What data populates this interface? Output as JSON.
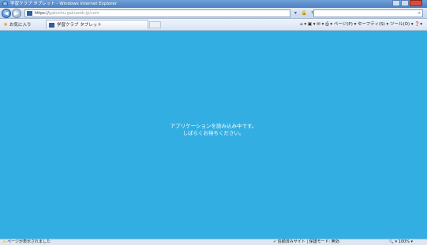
{
  "titlebar": {
    "title": "学習クラブ タブレット - Windows Internet Explorer"
  },
  "addressbar": {
    "url_prefix": "https://",
    "url_host": "gakushu.gakuweb.jp",
    "url_path": "/com",
    "search_placeholder": ""
  },
  "favbar": {
    "favorites_label": "お気に入り",
    "tab_title": "学習クラブ タブレット",
    "commands": "ページ(P) ▾  セーフティ(S) ▾  ツール(O) ▾"
  },
  "content": {
    "background": "#33aee2",
    "loading_line1": "アプリケーションを読み込み中です。",
    "loading_line2": "しばらくお待ちください。"
  },
  "statusbar": {
    "status_text": "ページが表示されました",
    "zone_text": "信頼済みサイト | 保護モード: 無効",
    "zoom_text": "100%"
  }
}
